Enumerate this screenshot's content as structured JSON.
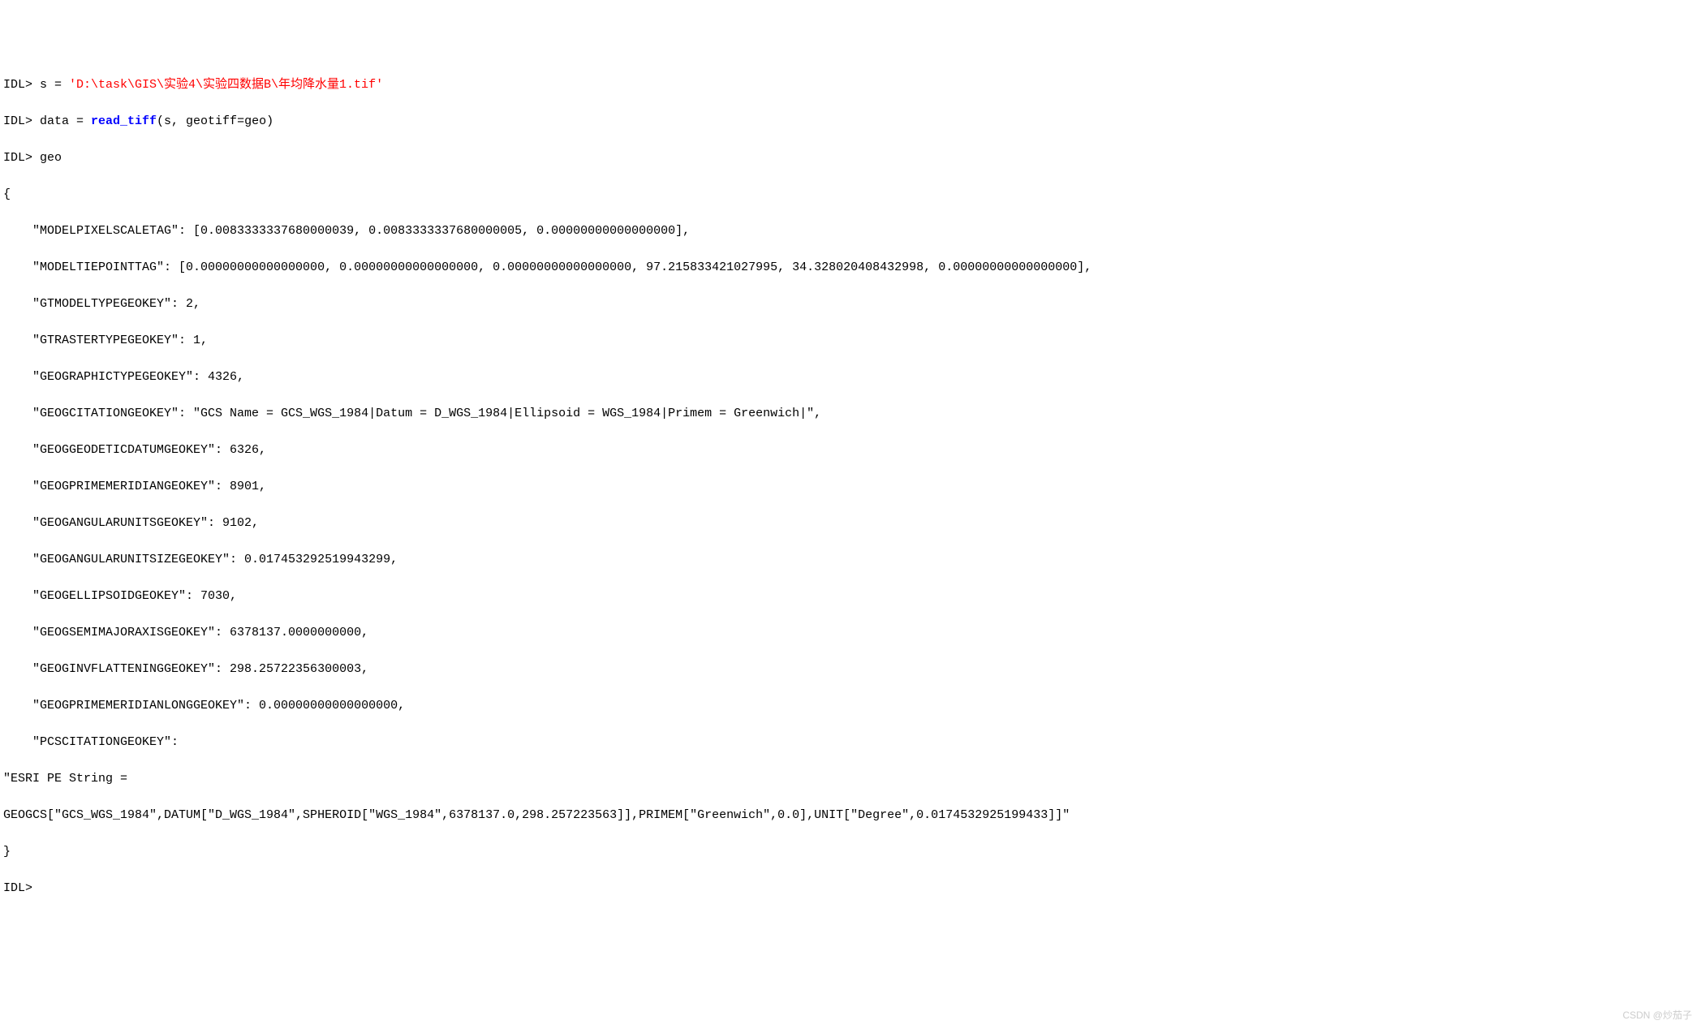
{
  "lines": {
    "l1": {
      "prompt": "IDL> ",
      "var": "s = ",
      "string": "'D:\\task\\GIS\\实验4\\实验四数据B\\年均降水量1.tif'"
    },
    "l2": {
      "prompt": "IDL> ",
      "before": "data = ",
      "func": "read_tiff",
      "after": "(s, geotiff=geo)"
    },
    "l3": {
      "prompt": "IDL> ",
      "after": "geo"
    },
    "l4": "{",
    "l5": "    \"MODELPIXELSCALETAG\": [0.0083333337680000039, 0.0083333337680000005, 0.00000000000000000],",
    "l6": "    \"MODELTIEPOINTTAG\": [0.00000000000000000, 0.00000000000000000, 0.00000000000000000, 97.215833421027995, 34.328020408432998, 0.00000000000000000],",
    "l7": "    \"GTMODELTYPEGEOKEY\": 2,",
    "l8": "    \"GTRASTERTYPEGEOKEY\": 1,",
    "l9": "    \"GEOGRAPHICTYPEGEOKEY\": 4326,",
    "l10": "    \"GEOGCITATIONGEOKEY\": \"GCS Name = GCS_WGS_1984|Datum = D_WGS_1984|Ellipsoid = WGS_1984|Primem = Greenwich|\",",
    "l11": "    \"GEOGGEODETICDATUMGEOKEY\": 6326,",
    "l12": "    \"GEOGPRIMEMERIDIANGEOKEY\": 8901,",
    "l13": "    \"GEOGANGULARUNITSGEOKEY\": 9102,",
    "l14": "    \"GEOGANGULARUNITSIZEGEOKEY\": 0.017453292519943299,",
    "l15": "    \"GEOGELLIPSOIDGEOKEY\": 7030,",
    "l16": "    \"GEOGSEMIMAJORAXISGEOKEY\": 6378137.0000000000,",
    "l17": "    \"GEOGINVFLATTENINGGEOKEY\": 298.25722356300003,",
    "l18": "    \"GEOGPRIMEMERIDIANLONGGEOKEY\": 0.00000000000000000,",
    "l19": "    \"PCSCITATIONGEOKEY\":",
    "l20": "\"ESRI PE String =",
    "l21": "GEOGCS[\"GCS_WGS_1984\",DATUM[\"D_WGS_1984\",SPHEROID[\"WGS_1984\",6378137.0,298.257223563]],PRIMEM[\"Greenwich\",0.0],UNIT[\"Degree\",0.0174532925199433]]\"",
    "l22": "}",
    "l23": {
      "prompt": "IDL> "
    }
  },
  "watermark": "CSDN @炒茄子"
}
